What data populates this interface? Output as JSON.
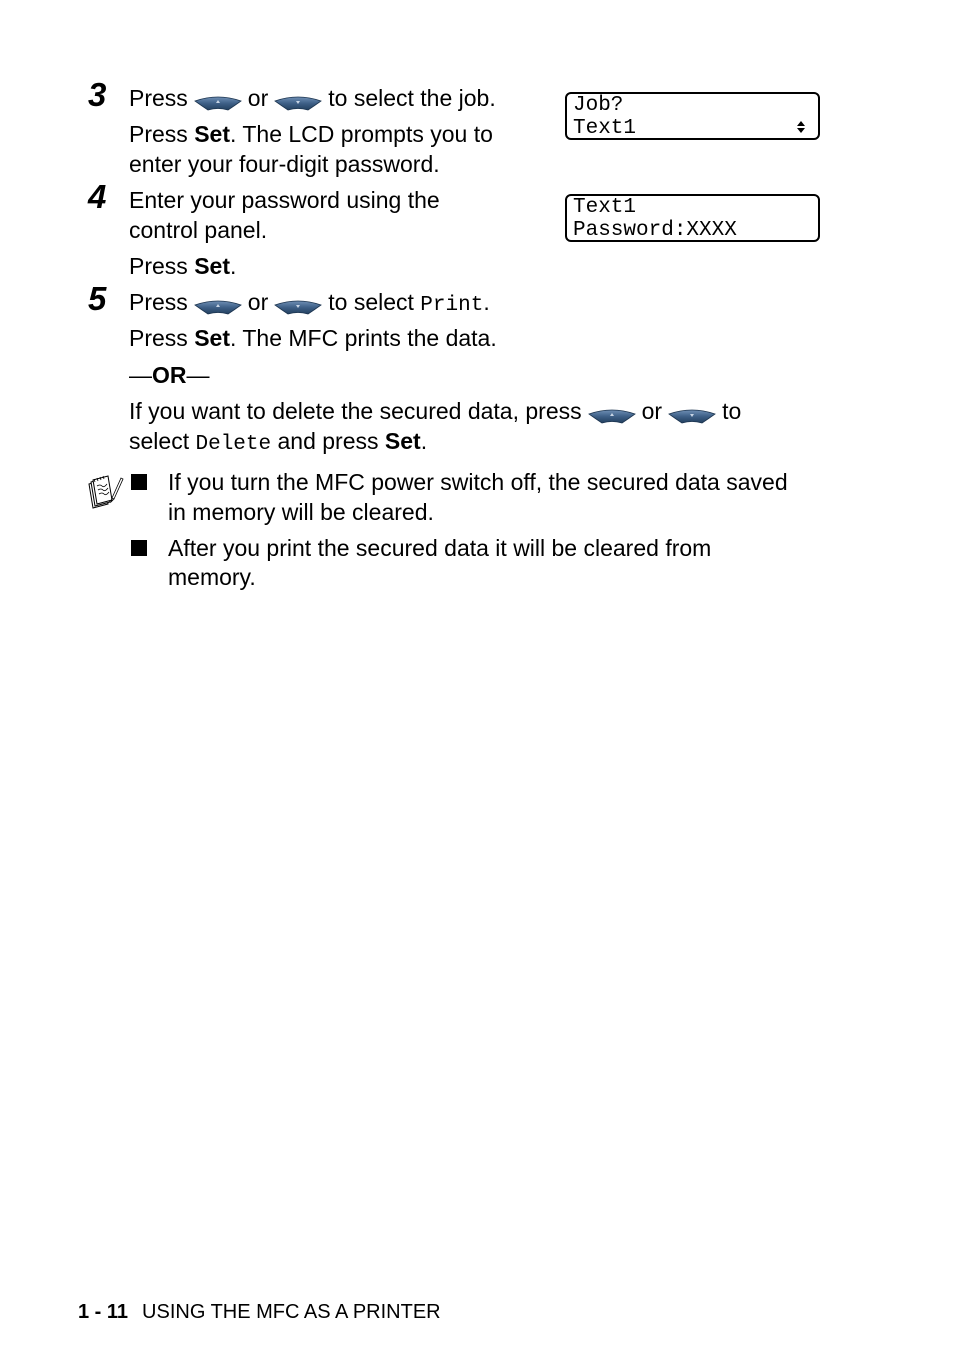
{
  "steps": [
    {
      "number": "3",
      "lines": {
        "l1_a": "Press",
        "l1_or": "or",
        "l1_b": "to select the job.",
        "l2_a": "Press ",
        "l2_bold": "Set",
        "l2_b": ". The LCD prompts you to",
        "l3": "enter your four-digit password."
      },
      "lcd": {
        "row1": "Job?",
        "row2": "Text1",
        "icon": "up-down-arrows-icon"
      }
    },
    {
      "number": "4",
      "lines": {
        "l1": "Enter your password using the",
        "l2": "control panel.",
        "l3_a": "Press ",
        "l3_bold": "Set",
        "l3_b": "."
      },
      "lcd": {
        "row1": "Text1",
        "row2": "Password:XXXX"
      }
    },
    {
      "number": "5",
      "lines": {
        "l1_a": "Press",
        "l1_or": "or",
        "l1_b": "to select ",
        "l1_mono": "Print",
        "l1_c": ".",
        "l2_a": "Press ",
        "l2_bold": "Set",
        "l2_b": ". The MFC prints the data.",
        "or_dash_left": "—",
        "or_bold": "OR",
        "or_dash_right": "—",
        "l4_a": "If you want to delete the secured data, press",
        "l4_or": "or",
        "l4_b": "to",
        "l5_a": "select ",
        "l5_mono": "Delete",
        "l5_b": " and press ",
        "l5_bold": "Set",
        "l5_c": "."
      }
    }
  ],
  "note": {
    "icon": "note-pad-pencil-icon",
    "bullets": [
      {
        "line1": "If you turn the MFC power switch off, the secured data saved",
        "line2": "in memory will be cleared."
      },
      {
        "line1": "After you print the secured data it will be cleared from",
        "line2": "memory."
      }
    ]
  },
  "buttons": {
    "up": "up-arrow-button",
    "down": "down-arrow-button",
    "color": "#3d5f86"
  },
  "footer": {
    "page": "1 - 11",
    "title": "USING THE MFC AS A PRINTER"
  }
}
